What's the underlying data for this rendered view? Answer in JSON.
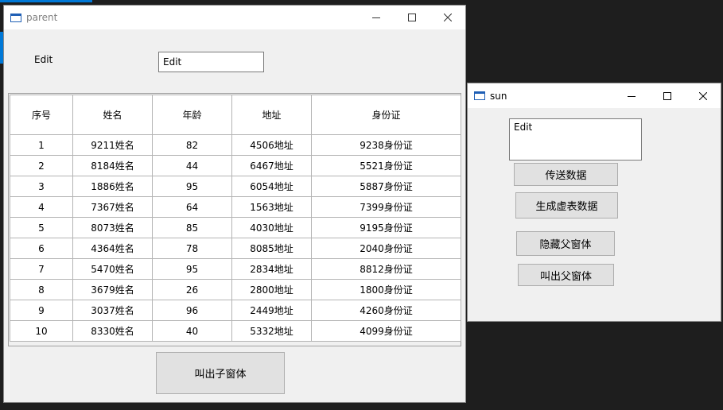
{
  "parent_window": {
    "title": "parent",
    "label": "Edit",
    "edit_value": "Edit",
    "table": {
      "columns": [
        "序号",
        "姓名",
        "年龄",
        "地址",
        "身份证"
      ],
      "rows": [
        [
          "1",
          "9211姓名",
          "82",
          "4506地址",
          "9238身份证"
        ],
        [
          "2",
          "8184姓名",
          "44",
          "6467地址",
          "5521身份证"
        ],
        [
          "3",
          "1886姓名",
          "95",
          "6054地址",
          "5887身份证"
        ],
        [
          "4",
          "7367姓名",
          "64",
          "1563地址",
          "7399身份证"
        ],
        [
          "5",
          "8073姓名",
          "85",
          "4030地址",
          "9195身份证"
        ],
        [
          "6",
          "4364姓名",
          "78",
          "8085地址",
          "2040身份证"
        ],
        [
          "7",
          "5470姓名",
          "95",
          "2834地址",
          "8812身份证"
        ],
        [
          "8",
          "3679姓名",
          "26",
          "2800地址",
          "1800身份证"
        ],
        [
          "9",
          "3037姓名",
          "96",
          "2449地址",
          "4260身份证"
        ],
        [
          "10",
          "8330姓名",
          "40",
          "5332地址",
          "4099身份证"
        ]
      ]
    },
    "button_label": "叫出子窗体"
  },
  "sun_window": {
    "title": "sun",
    "edit_value": "Edit",
    "buttons": [
      "传送数据",
      "生成虚表数据",
      "隐藏父窗体",
      "叫出父窗体"
    ]
  },
  "icons": [
    "window-icon",
    "minimize-icon",
    "maximize-icon",
    "close-icon"
  ],
  "colors": {
    "titlebar": "#ffffff",
    "client": "#f0f0f0",
    "button": "#e1e1e1",
    "accent": "#0078d7"
  }
}
